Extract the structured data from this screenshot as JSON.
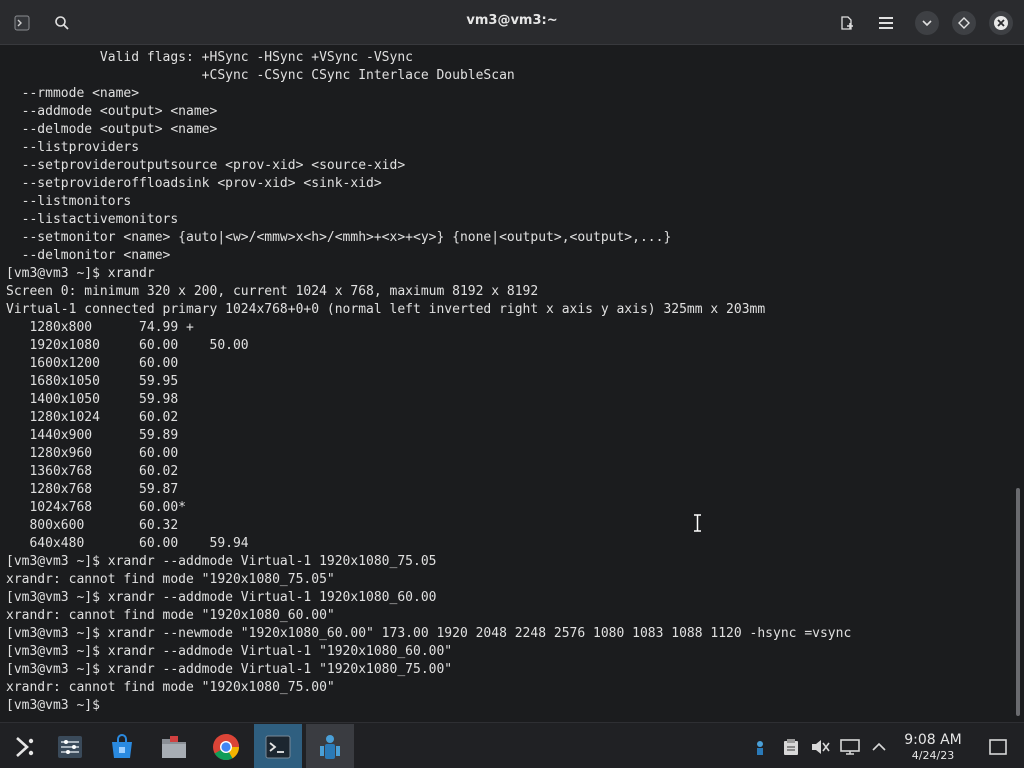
{
  "window": {
    "title": "vm3@vm3:~"
  },
  "terminal": {
    "lines": [
      "            Valid flags: +HSync -HSync +VSync -VSync",
      "                         +CSync -CSync CSync Interlace DoubleScan",
      "  --rmmode <name>",
      "  --addmode <output> <name>",
      "  --delmode <output> <name>",
      "  --listproviders",
      "  --setprovideroutputsource <prov-xid> <source-xid>",
      "  --setprovideroffloadsink <prov-xid> <sink-xid>",
      "  --listmonitors",
      "  --listactivemonitors",
      "  --setmonitor <name> {auto|<w>/<mmw>x<h>/<mmh>+<x>+<y>} {none|<output>,<output>,...}",
      "  --delmonitor <name>",
      "[vm3@vm3 ~]$ xrandr",
      "Screen 0: minimum 320 x 200, current 1024 x 768, maximum 8192 x 8192",
      "Virtual-1 connected primary 1024x768+0+0 (normal left inverted right x axis y axis) 325mm x 203mm",
      "   1280x800      74.99 +",
      "   1920x1080     60.00    50.00",
      "   1600x1200     60.00",
      "   1680x1050     59.95",
      "   1400x1050     59.98",
      "   1280x1024     60.02",
      "   1440x900      59.89",
      "   1280x960      60.00",
      "   1360x768      60.02",
      "   1280x768      59.87",
      "   1024x768      60.00*",
      "   800x600       60.32",
      "   640x480       60.00    59.94",
      "[vm3@vm3 ~]$ xrandr --addmode Virtual-1 1920x1080_75.05",
      "xrandr: cannot find mode \"1920x1080_75.05\"",
      "[vm3@vm3 ~]$ xrandr --addmode Virtual-1 1920x1080_60.00",
      "xrandr: cannot find mode \"1920x1080_60.00\"",
      "[vm3@vm3 ~]$ xrandr --newmode \"1920x1080_60.00\" 173.00 1920 2048 2248 2576 1080 1083 1088 1120 -hsync =vsync",
      "[vm3@vm3 ~]$ xrandr --addmode Virtual-1 \"1920x1080_60.00\"",
      "[vm3@vm3 ~]$ xrandr --addmode Virtual-1 \"1920x1080_75.00\"",
      "xrandr: cannot find mode \"1920x1080_75.00\"",
      "[vm3@vm3 ~]$ "
    ]
  },
  "titlebar_icons": {
    "terminal": "terminal-icon",
    "search": "search-icon",
    "new_tab": "new-tab-icon",
    "menu": "hamburger-menu-icon",
    "minimize": "chevron-down-icon",
    "maximize": "diamond-icon",
    "close": "close-icon"
  },
  "taskbar": {
    "apps": [
      "application-launcher-icon",
      "system-settings-icon",
      "discover-store-icon",
      "file-manager-icon",
      "chrome-icon",
      "konsole-terminal-icon",
      "vm-tool-icon"
    ],
    "tray": [
      "network-icon",
      "clipboard-icon",
      "volume-muted-icon",
      "display-icon",
      "tray-expand-icon",
      "show-desktop-icon"
    ],
    "clock_time": "9:08 AM",
    "clock_date": "4/24/23"
  },
  "colors": {
    "accent": "#2f5f80",
    "titlebar": "#2a2b2e",
    "terminal_bg": "#1b1c1e",
    "close_red": "#e0545c"
  }
}
